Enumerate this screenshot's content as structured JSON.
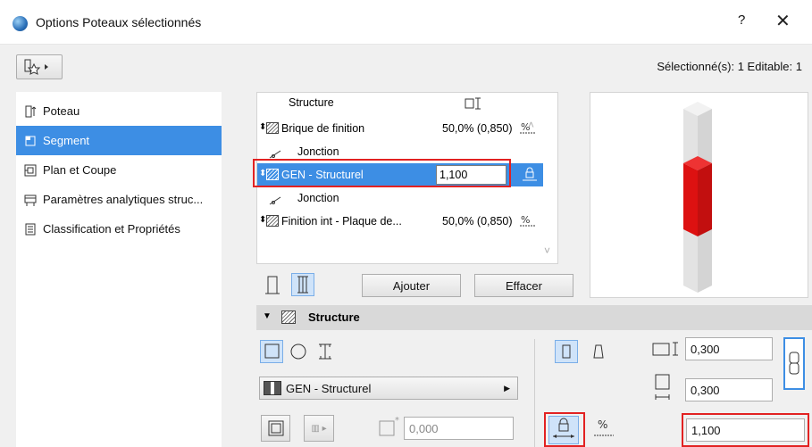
{
  "window": {
    "title": "Options Poteaux sélectionnés",
    "help": "?",
    "close": "✕"
  },
  "header": {
    "selection_info": "Sélectionné(s): 1 Editable: 1"
  },
  "nav": {
    "items": [
      {
        "label": "Poteau",
        "icon": "column-icon"
      },
      {
        "label": "Segment",
        "icon": "segment-icon"
      },
      {
        "label": "Plan et Coupe",
        "icon": "floorplan-icon"
      },
      {
        "label": "Paramètres analytiques struc...",
        "icon": "analytics-icon"
      },
      {
        "label": "Classification et Propriétés",
        "icon": "properties-icon"
      }
    ]
  },
  "layers": {
    "header_label": "Structure",
    "rows": [
      {
        "type": "skin",
        "name": "Brique de finition",
        "value": "50,0% (0,850)"
      },
      {
        "type": "junction",
        "name": "Jonction"
      },
      {
        "type": "core",
        "name": "GEN - Structurel",
        "value": "1,100"
      },
      {
        "type": "junction",
        "name": "Jonction"
      },
      {
        "type": "skin",
        "name": "Finition int - Plaque de...",
        "value": "50,0% (0,850)"
      }
    ]
  },
  "buttons": {
    "add": "Ajouter",
    "delete": "Effacer"
  },
  "section": {
    "title": "Structure"
  },
  "structure": {
    "material": "GEN - Structurel",
    "offset_value": "0,000",
    "dim_width": "0,300",
    "dim_depth": "0,300",
    "core_thickness": "1,100"
  },
  "colors": {
    "accent": "#3d8ee4",
    "highlight_red": "#e22222",
    "core_red": "#dd1111"
  }
}
